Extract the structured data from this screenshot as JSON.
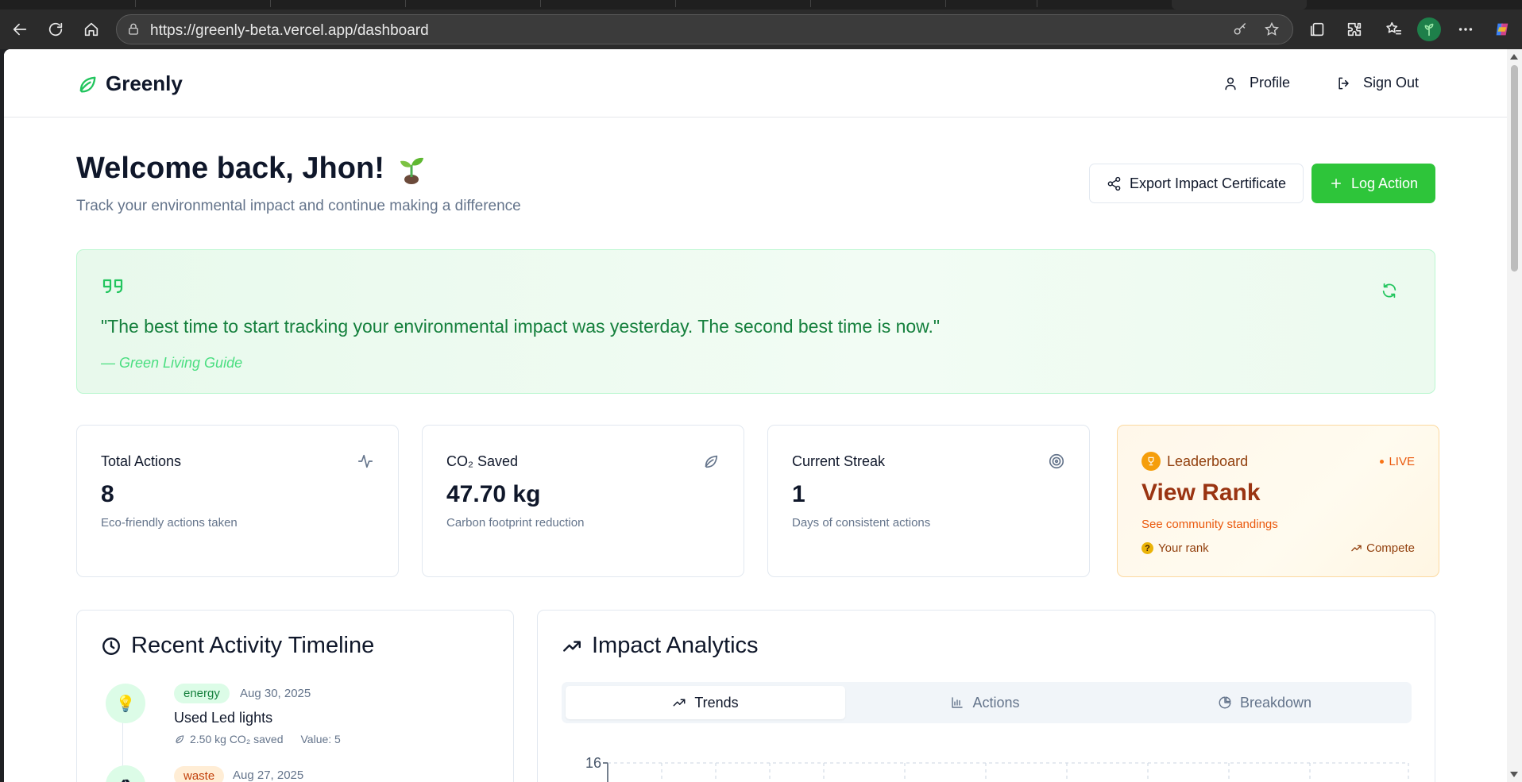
{
  "browser": {
    "url": "https://greenly-beta.vercel.app/dashboard"
  },
  "header": {
    "brand": "Greenly",
    "profile_label": "Profile",
    "signout_label": "Sign Out"
  },
  "welcome": {
    "title": "Welcome back, Jhon!",
    "subtitle": "Track your environmental impact and continue making a difference",
    "export_label": "Export Impact Certificate",
    "log_label": "Log Action"
  },
  "quote": {
    "text": "\"The best time to start tracking your environmental impact was yesterday. The second best time is now.\"",
    "author": "— Green Living Guide"
  },
  "stats": [
    {
      "label": "Total Actions",
      "value": "8",
      "desc": "Eco-friendly actions taken",
      "icon": "activity-icon"
    },
    {
      "label": "CO₂ Saved",
      "value": "47.70 kg",
      "desc": "Carbon footprint reduction",
      "icon": "leaf-icon"
    },
    {
      "label": "Current Streak",
      "value": "1",
      "desc": "Days of consistent actions",
      "icon": "target-icon"
    }
  ],
  "leaderboard": {
    "label": "Leaderboard",
    "live": "LIVE",
    "title": "View Rank",
    "subtitle": "See community standings",
    "rank_label": "Your rank",
    "rank_badge": "?",
    "compete_label": "Compete"
  },
  "timeline": {
    "title": "Recent Activity Timeline",
    "items": [
      {
        "tag": "energy",
        "date": "Aug 30, 2025",
        "title": "Used Led lights",
        "co2": "2.50 kg CO₂ saved",
        "value": "Value: 5",
        "emoji": "💡"
      },
      {
        "tag": "waste",
        "date": "Aug 27, 2025",
        "emoji": "♻"
      }
    ]
  },
  "analytics": {
    "title": "Impact Analytics",
    "tabs": [
      "Trends",
      "Actions",
      "Breakdown"
    ],
    "active_tab": "Trends"
  },
  "chart_data": {
    "type": "line",
    "y_tick_top": "16"
  },
  "colors": {
    "brand_green": "#2ec53a",
    "quote_green": "#15803d",
    "leaderboard_orange": "#9a3412"
  }
}
